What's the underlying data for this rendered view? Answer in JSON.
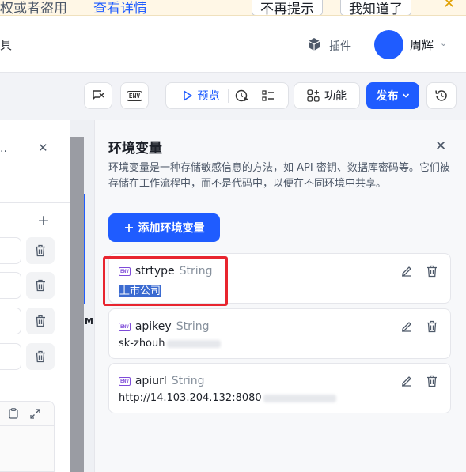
{
  "notice": {
    "text": "权或者盗用",
    "link": "查看详情",
    "btn_no_remind": "不再提示",
    "btn_got_it": "我知道了",
    "close": "✕"
  },
  "header": {
    "tool_label": "具",
    "plugin_label": "插件",
    "user_name": "周辉"
  },
  "toolbar": {
    "variable_icon": "ENV",
    "preview_label": "预览",
    "function_label": "功能",
    "publish_label": "发布"
  },
  "left_panel": {
    "close": "✕",
    "add": "+"
  },
  "canvas": {
    "node_letter": "M"
  },
  "env_panel": {
    "title": "环境变量",
    "close": "✕",
    "description": "环境变量是一种存储敏感信息的方法，如 API 密钥、数据库密码等。它们被存储在工作流程中，而不是代码中，以便在不同环境中共享。",
    "add_button": "添加环境变量",
    "badge": "ENV",
    "variables": [
      {
        "name": "strtype",
        "type": "String",
        "value": "上市公司"
      },
      {
        "name": "apikey",
        "type": "String",
        "value": "sk-zhouh"
      },
      {
        "name": "apiurl",
        "type": "String",
        "value": "http://14.103.204.132:8080"
      }
    ]
  },
  "colors": {
    "primary": "#1f5cff",
    "highlight": "#e8252f",
    "env_badge": "#7e4bd8"
  }
}
